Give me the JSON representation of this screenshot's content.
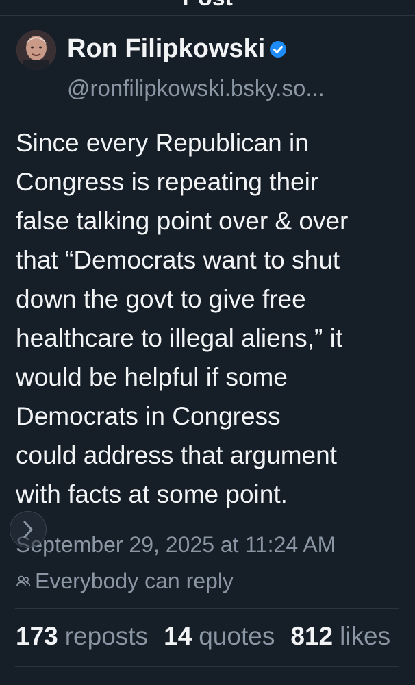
{
  "header": {
    "title": "Post"
  },
  "author": {
    "name": "Ron Filipkowski",
    "handle": "@ronfilipkowski.bsky.so...",
    "verified": true
  },
  "post": {
    "text": "Since every Republican in\nCongress is repeating their\nfalse talking point over & over\nthat “Democrats want to shut\ndown the govt to give free\nhealthcare to illegal aliens,” it\nwould be helpful if some\nDemocrats in Congress\ncould address that argument\nwith facts at some point.",
    "timestamp": "September 29, 2025 at 11:24 AM",
    "reply_setting": "Everybody can reply"
  },
  "stats": {
    "reposts_count": "173",
    "reposts_label": "reposts",
    "quotes_count": "14",
    "quotes_label": "quotes",
    "likes_count": "812",
    "likes_label": "likes"
  },
  "icons": {
    "verified": "verified-badge-icon",
    "reply": "people-icon",
    "nav": "chevron-right-icon"
  },
  "colors": {
    "background": "#161e27",
    "text": "#f1f3f5",
    "muted": "#8a96a3",
    "verified": "#1d8cf8"
  }
}
